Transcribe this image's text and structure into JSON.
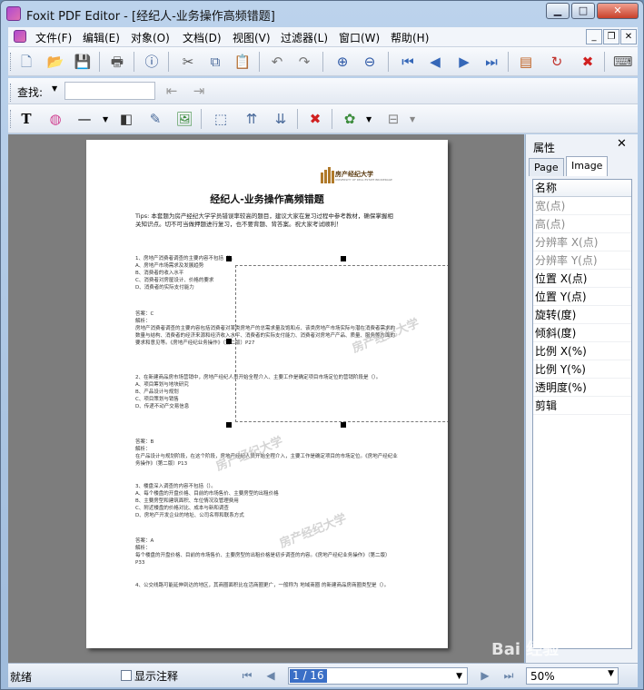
{
  "window": {
    "title": "Foxit PDF Editor - [经纪人-业务操作高频错题]"
  },
  "menu": [
    "文件(F)",
    "编辑(E)",
    "对象(O)",
    "文档(D)",
    "视图(V)",
    "过滤器(L)",
    "窗口(W)",
    "帮助(H)"
  ],
  "find": {
    "label": "查找:",
    "value": ""
  },
  "document": {
    "title": "经纪人-业务操作高频错题",
    "logo_text": "房产经纪大学",
    "logo_sub": "UNIVERSITY OF REAL ESTATE BROKERAGE",
    "tips": "Tips: 本套题为房产经纪大学学员错误率较高的题目，建议大家在复习过程中参考教材，确保掌握相关知识点。切不可当做押题进行复习，也不要背题、背答案。祝大家考试顺利！",
    "q1": "1、房地产消费者调查的主要内容不包括（）。\nA、房地产市场需求及发展趋势\nB、消费者的收入水平\nC、消费者对房屋设计、价格的要求\nD、消费者的实际支付能力",
    "a1": "答案：C\n解析：\n房地产消费者调查的主要内容包括消费者对某类房地产的总需求量及饱和点、该类房地产市场实际与潜在消费者需求的数量与结构、消费者的经济来源和经济收入水平、消费者的实际支付能力、消费者对房地产产品、质量、服务等方面的要求和意见等。《房地产经纪业务操作》（第二版）P27",
    "q2": "2、在新建商品房市场营销中，房地产经纪人员开始全程介入、主要工作是确定项目市场定位的营销阶段是（）。\nA、项目筹划与地块研究\nB、产品设计与规划\nC、项目策划与销售\nD、传递不动产交易信息",
    "a2": "答案：B\n解析：\n在产品设计与规划阶段，在这个阶段，房地产经纪人员开始全程介入，主要工作是确定项目的市场定位。《房地产经纪业务操作》（第二版）P13",
    "q3": "3、楼盘深入调查的内容不包括（）。\nA、每个楼盘的开盘价格、目前的市场售价、主要房型的出租价格\nB、主要房型和建筑面积、车位情况及管理费用\nC、附近楼盘的价格对比、成本与新和调查\nD、房地产开发企业的地址、公司名称和联系方式",
    "a3": "答案：A\n解析：\n每个楼盘的开盘价格、目前的市场售价、主要房型的出租价格是初步调查的内容。《房地产经纪业务操作》（第二版）P33",
    "q4": "4、公交线路可能延伸到达的地区，其商圈面积比在活商圈更广，一般称为 地域商圈 的新建商品房商圈类型是（）。",
    "watermark": "房产经纪大学"
  },
  "props": {
    "title": "属性",
    "tabs": [
      "Page",
      "Image"
    ],
    "header": "名称",
    "rows": [
      {
        "label": "宽(点)",
        "disabled": true
      },
      {
        "label": "高(点)",
        "disabled": true
      },
      {
        "label": "分辨率 X(点)",
        "disabled": true
      },
      {
        "label": "分辨率 Y(点)",
        "disabled": true
      },
      {
        "label": "位置 X(点)",
        "disabled": false
      },
      {
        "label": "位置 Y(点)",
        "disabled": false
      },
      {
        "label": "旋转(度)",
        "disabled": false
      },
      {
        "label": "倾斜(度)",
        "disabled": false
      },
      {
        "label": "比例 X(%)",
        "disabled": false
      },
      {
        "label": "比例 Y(%)",
        "disabled": false
      },
      {
        "label": "透明度(%)",
        "disabled": false
      },
      {
        "label": "剪辑",
        "disabled": false
      }
    ]
  },
  "status": {
    "text": "就绪",
    "show_annotations": "显示注释",
    "page_value": "1 / 16",
    "zoom": "50%"
  },
  "baidu_watermark": "Bai 经验"
}
